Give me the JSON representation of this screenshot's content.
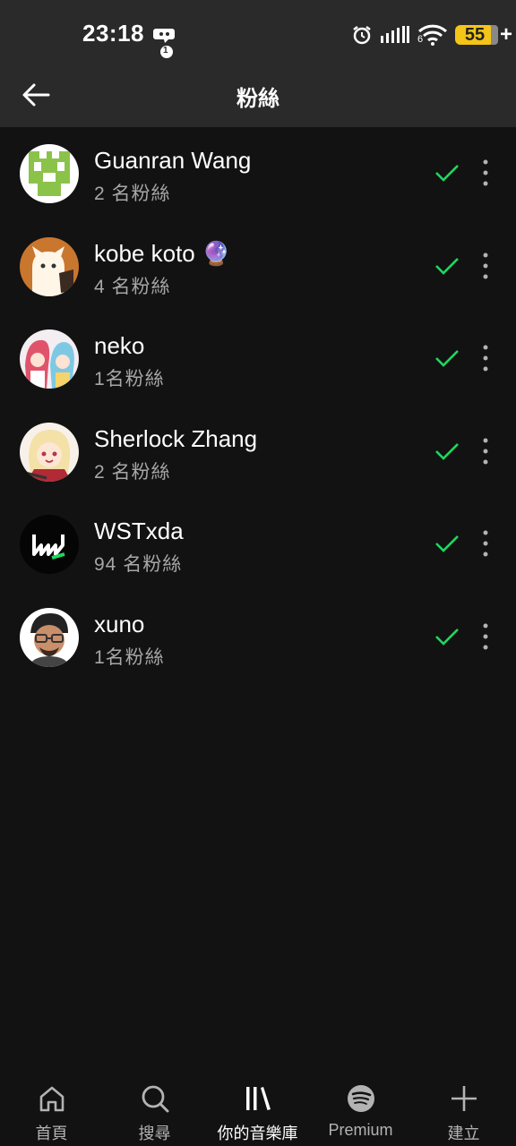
{
  "status_bar": {
    "time": "23:18",
    "notification_count": "1",
    "battery_level": "55",
    "network_label": "6"
  },
  "header": {
    "title": "粉絲"
  },
  "followers": [
    {
      "name": "Guanran Wang",
      "followers_text": "2 名粉絲"
    },
    {
      "name": "kobe koto 🔮",
      "followers_text": "4 名粉絲"
    },
    {
      "name": "neko",
      "followers_text": "1名粉絲"
    },
    {
      "name": "Sherlock Zhang",
      "followers_text": "2 名粉絲"
    },
    {
      "name": "WSTxda",
      "followers_text": "94 名粉絲"
    },
    {
      "name": "xuno",
      "followers_text": "1名粉絲"
    }
  ],
  "bottom_nav": [
    {
      "label": "首頁",
      "icon": "home-icon"
    },
    {
      "label": "搜尋",
      "icon": "search-icon"
    },
    {
      "label": "你的音樂庫",
      "icon": "library-icon"
    },
    {
      "label": "Premium",
      "icon": "spotify-icon"
    },
    {
      "label": "建立",
      "icon": "plus-icon"
    }
  ],
  "colors": {
    "accent_green": "#1ed760",
    "background": "#121212",
    "header_bg": "#2a2a2a",
    "battery": "#f5c518"
  }
}
